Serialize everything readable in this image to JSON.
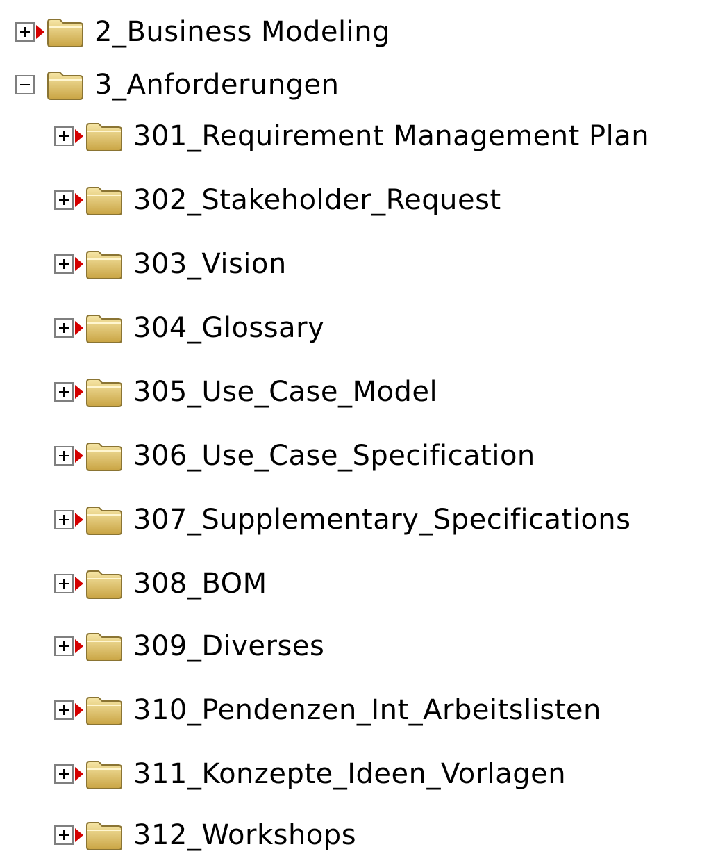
{
  "tree": {
    "items": [
      {
        "label": "2_Business Modeling",
        "level": 0,
        "expanded": false,
        "marker": true
      },
      {
        "label": "3_Anforderungen",
        "level": 0,
        "expanded": true,
        "marker": false
      },
      {
        "label": "301_Requirement Management Plan",
        "level": 1,
        "expanded": false,
        "marker": true
      },
      {
        "label": "302_Stakeholder_Request",
        "level": 1,
        "expanded": false,
        "marker": true
      },
      {
        "label": "303_Vision",
        "level": 1,
        "expanded": false,
        "marker": true
      },
      {
        "label": "304_Glossary",
        "level": 1,
        "expanded": false,
        "marker": true
      },
      {
        "label": "305_Use_Case_Model",
        "level": 1,
        "expanded": false,
        "marker": true
      },
      {
        "label": "306_Use_Case_Specification",
        "level": 1,
        "expanded": false,
        "marker": true
      },
      {
        "label": "307_Supplementary_Specifications",
        "level": 1,
        "expanded": false,
        "marker": true
      },
      {
        "label": "308_BOM",
        "level": 1,
        "expanded": false,
        "marker": true
      },
      {
        "label": "309_Diverses",
        "level": 1,
        "expanded": false,
        "marker": true
      },
      {
        "label": "310_Pendenzen_Int_Arbeitslisten",
        "level": 1,
        "expanded": false,
        "marker": true
      },
      {
        "label": "311_Konzepte_Ideen_Vorlagen",
        "level": 1,
        "expanded": false,
        "marker": true
      },
      {
        "label": "312_Workshops",
        "level": 1,
        "expanded": false,
        "marker": true
      }
    ]
  },
  "colors": {
    "marker": "#d40000",
    "folder_fill": "#e6c766",
    "folder_stroke": "#8a7433",
    "toggle_border": "#7f7f7f"
  },
  "icons": {
    "expand": "plus-box-icon",
    "collapse": "minus-box-icon",
    "folder": "folder-icon",
    "marker": "red-triangle-icon"
  }
}
